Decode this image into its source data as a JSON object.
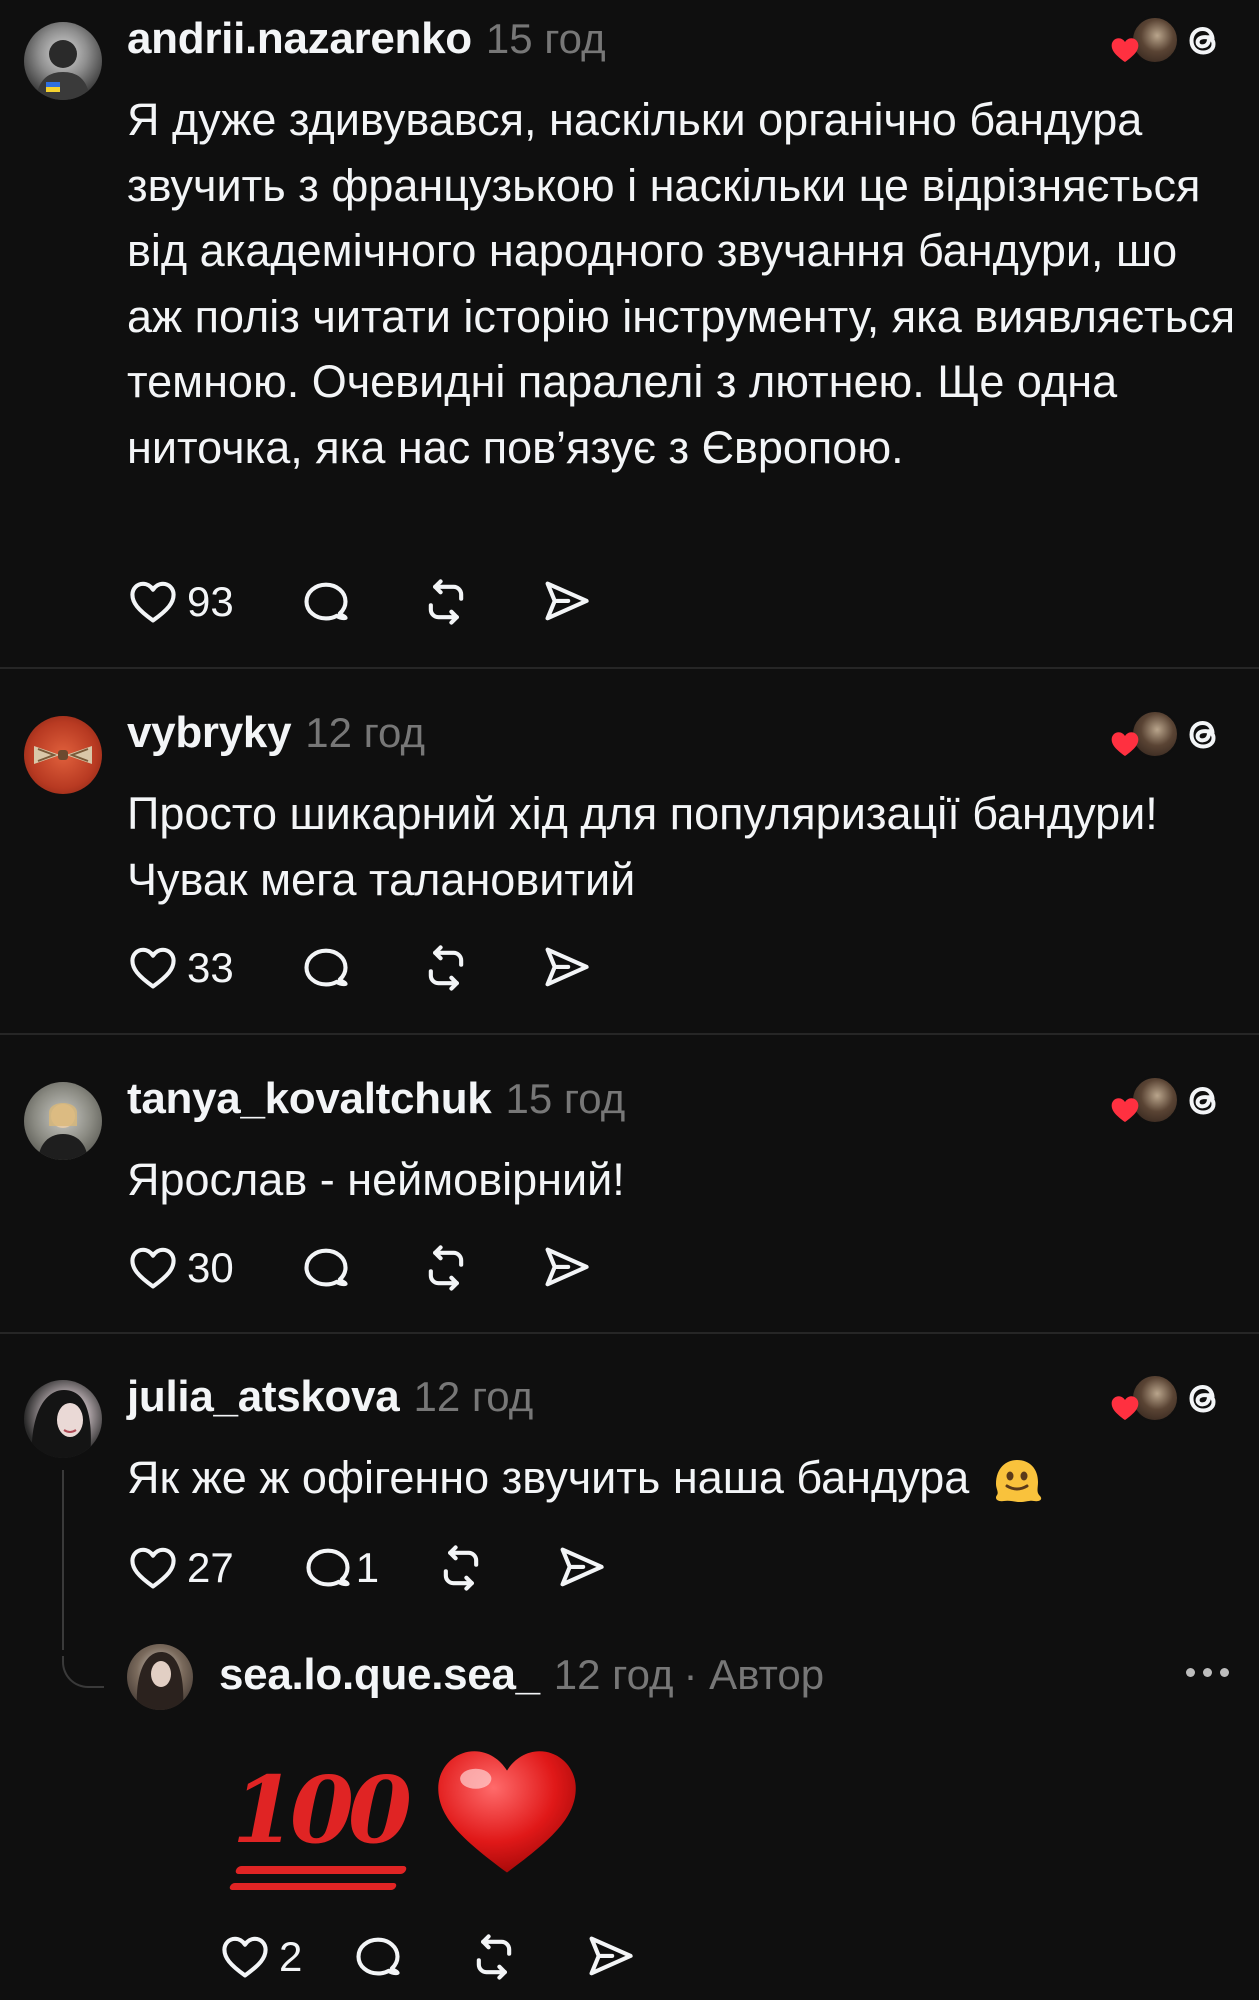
{
  "posts": [
    {
      "username": "andrii.nazarenko",
      "time": "15 год",
      "text": "Я дуже здивувався, наскільки органічно бандура звучить з французькою і наскільки це відрізняється від академічного народного звучання бандури, шо аж поліз читати історію інструменту, яка виявляється темною. Очевидні паралелі з лютнею. Ще одна ниточка, яка нас пов’язує з Європою.",
      "likes": "93",
      "replies": ""
    },
    {
      "username": "vybryky",
      "time": "12 год",
      "text": "Просто шикарний хід для популяризації бандури! Чувак мега талановитий",
      "likes": "33",
      "replies": ""
    },
    {
      "username": "tanya_kovaltchuk",
      "time": "15 год",
      "text": "Ярослав - неймовірний!",
      "likes": "30",
      "replies": ""
    },
    {
      "username": "julia_atskova",
      "time": "12 год",
      "text": "Як же ж офігенно звучить наша бандура",
      "emoji": "melting-face",
      "likes": "27",
      "replies": "1"
    }
  ],
  "reply": {
    "username": "sea.lo.que.sea_",
    "time": "12 год",
    "author_label": "· Автор",
    "emojis": [
      "hundred-points",
      "red-heart"
    ],
    "likes": "2"
  },
  "colors": {
    "background": "#0f0f0f",
    "text": "#f3f5f7",
    "secondary": "#777777",
    "like_red": "#ff3040"
  }
}
